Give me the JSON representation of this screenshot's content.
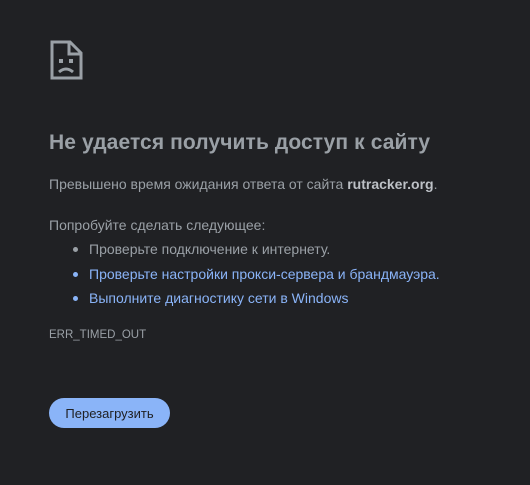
{
  "error_page": {
    "icon": "sad-page-icon",
    "title": "Не удается получить доступ к сайту",
    "description_prefix": "Превышено время ожидания ответа от сайта ",
    "host": "rutracker.org",
    "description_suffix": ".",
    "try_heading": "Попробуйте сделать следующее:",
    "suggestions": [
      {
        "label": "Проверьте подключение к интернету.",
        "is_link": false
      },
      {
        "label": "Проверьте настройки прокси-сервера и брандмауэра.",
        "is_link": true
      },
      {
        "label": "Выполните диагностику сети в Windows",
        "is_link": true
      }
    ],
    "error_code": "ERR_TIMED_OUT",
    "reload_label": "Перезагрузить"
  },
  "colors": {
    "background": "#202124",
    "text": "#9aa0a6",
    "link": "#8ab4f8",
    "button": "#8ab4f8"
  }
}
